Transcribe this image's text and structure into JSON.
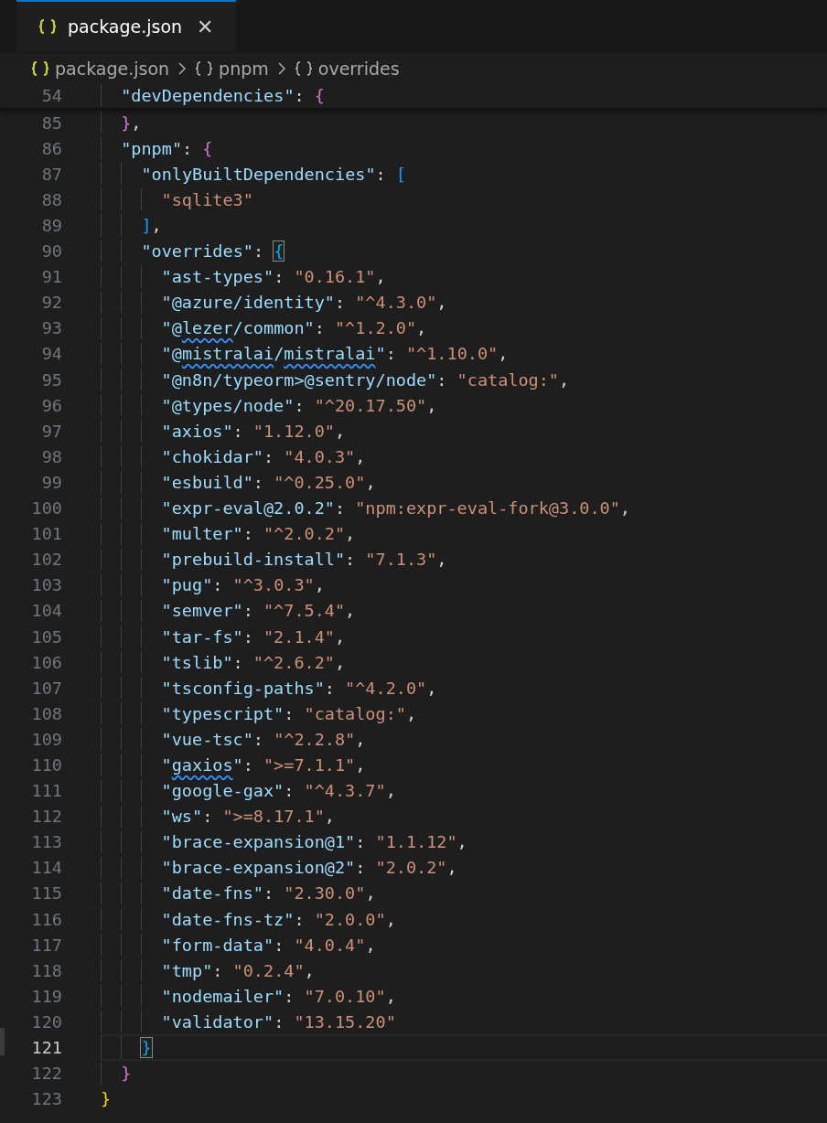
{
  "tab": {
    "title": "package.json",
    "selected": true,
    "close": "✕"
  },
  "breadcrumbs": [
    {
      "label": "package.json"
    },
    {
      "label": "pnpm"
    },
    {
      "label": "overrides"
    }
  ],
  "sticky_scroll": {
    "children": [
      {
        "number": "54",
        "current": false,
        "tokens": [
          {
            "kind": "key",
            "text": "\"devDependencies\""
          },
          {
            "kind": "punct",
            "text": ": "
          },
          {
            "kind": "brace-2",
            "text": "{"
          }
        ]
      }
    ]
  },
  "root_block": {
    "children": [
      {
        "number": "85",
        "current": false,
        "tokens": [
          {
            "kind": "brace-2",
            "text": "}"
          },
          {
            "kind": "punct",
            "text": ","
          }
        ]
      },
      {
        "number": "86",
        "current": false,
        "tokens": [
          {
            "kind": "key",
            "text": "\"pnpm\""
          },
          {
            "kind": "punct",
            "text": ": "
          },
          {
            "kind": "brace-2",
            "text": "{"
          }
        ],
        "children": [
          {
            "number": "87",
            "current": false,
            "tokens": [
              {
                "kind": "key",
                "text": "\"onlyBuiltDependencies\""
              },
              {
                "kind": "punct",
                "text": ": "
              },
              {
                "kind": "brace-3",
                "text": "["
              }
            ],
            "children": [
              {
                "number": "88",
                "current": false,
                "tokens": [
                  {
                    "kind": "string",
                    "text": "\"sqlite3\""
                  }
                ]
              }
            ]
          },
          {
            "number": "89",
            "current": false,
            "tokens": [
              {
                "kind": "brace-3",
                "text": "]"
              },
              {
                "kind": "punct",
                "text": ","
              }
            ]
          },
          {
            "number": "90",
            "current": false,
            "tokens": [
              {
                "kind": "key",
                "text": "\"overrides\""
              },
              {
                "kind": "punct",
                "text": ": "
              },
              {
                "kind": "brace-3",
                "text": "{",
                "matched": true
              }
            ],
            "children": [
              {
                "number": "91",
                "current": false,
                "tokens": [
                  {
                    "kind": "key",
                    "text": "\"ast-types\""
                  },
                  {
                    "kind": "punct",
                    "text": ": "
                  },
                  {
                    "kind": "string",
                    "text": "\"0.16.1\""
                  },
                  {
                    "kind": "punct",
                    "text": ","
                  }
                ]
              },
              {
                "number": "92",
                "current": false,
                "tokens": [
                  {
                    "kind": "key",
                    "text": "\"@azure/identity\""
                  },
                  {
                    "kind": "punct",
                    "text": ": "
                  },
                  {
                    "kind": "string",
                    "text": "\"^4.3.0\""
                  },
                  {
                    "kind": "punct",
                    "text": ","
                  }
                ]
              },
              {
                "number": "93",
                "current": false,
                "tokens": [
                  {
                    "kind": "key",
                    "text": "\"@"
                  },
                  {
                    "kind": "key",
                    "text": "lezer",
                    "squiggle": true
                  },
                  {
                    "kind": "key",
                    "text": "/common\""
                  },
                  {
                    "kind": "punct",
                    "text": ": "
                  },
                  {
                    "kind": "string",
                    "text": "\"^1.2.0\""
                  },
                  {
                    "kind": "punct",
                    "text": ","
                  }
                ]
              },
              {
                "number": "94",
                "current": false,
                "tokens": [
                  {
                    "kind": "key",
                    "text": "\"@"
                  },
                  {
                    "kind": "key",
                    "text": "mistralai",
                    "squiggle": true
                  },
                  {
                    "kind": "key",
                    "text": "/"
                  },
                  {
                    "kind": "key",
                    "text": "mistralai",
                    "squiggle": true
                  },
                  {
                    "kind": "key",
                    "text": "\""
                  },
                  {
                    "kind": "punct",
                    "text": ": "
                  },
                  {
                    "kind": "string",
                    "text": "\"^1.10.0\""
                  },
                  {
                    "kind": "punct",
                    "text": ","
                  }
                ]
              },
              {
                "number": "95",
                "current": false,
                "tokens": [
                  {
                    "kind": "key",
                    "text": "\"@n8n/typeorm>@sentry/node\""
                  },
                  {
                    "kind": "punct",
                    "text": ": "
                  },
                  {
                    "kind": "string",
                    "text": "\"catalog:\""
                  },
                  {
                    "kind": "punct",
                    "text": ","
                  }
                ]
              },
              {
                "number": "96",
                "current": false,
                "tokens": [
                  {
                    "kind": "key",
                    "text": "\"@types/node\""
                  },
                  {
                    "kind": "punct",
                    "text": ": "
                  },
                  {
                    "kind": "string",
                    "text": "\"^20.17.50\""
                  },
                  {
                    "kind": "punct",
                    "text": ","
                  }
                ]
              },
              {
                "number": "97",
                "current": false,
                "tokens": [
                  {
                    "kind": "key",
                    "text": "\"axios\""
                  },
                  {
                    "kind": "punct",
                    "text": ": "
                  },
                  {
                    "kind": "string",
                    "text": "\"1.12.0\""
                  },
                  {
                    "kind": "punct",
                    "text": ","
                  }
                ]
              },
              {
                "number": "98",
                "current": false,
                "tokens": [
                  {
                    "kind": "key",
                    "text": "\"chokidar\""
                  },
                  {
                    "kind": "punct",
                    "text": ": "
                  },
                  {
                    "kind": "string",
                    "text": "\"4.0.3\""
                  },
                  {
                    "kind": "punct",
                    "text": ","
                  }
                ]
              },
              {
                "number": "99",
                "current": false,
                "tokens": [
                  {
                    "kind": "key",
                    "text": "\"esbuild\""
                  },
                  {
                    "kind": "punct",
                    "text": ": "
                  },
                  {
                    "kind": "string",
                    "text": "\"^0.25.0\""
                  },
                  {
                    "kind": "punct",
                    "text": ","
                  }
                ]
              },
              {
                "number": "100",
                "current": false,
                "tokens": [
                  {
                    "kind": "key",
                    "text": "\"expr-eval@2.0.2\""
                  },
                  {
                    "kind": "punct",
                    "text": ": "
                  },
                  {
                    "kind": "string",
                    "text": "\"npm:expr-eval-fork@3.0.0\""
                  },
                  {
                    "kind": "punct",
                    "text": ","
                  }
                ]
              },
              {
                "number": "101",
                "current": false,
                "tokens": [
                  {
                    "kind": "key",
                    "text": "\"multer\""
                  },
                  {
                    "kind": "punct",
                    "text": ": "
                  },
                  {
                    "kind": "string",
                    "text": "\"^2.0.2\""
                  },
                  {
                    "kind": "punct",
                    "text": ","
                  }
                ]
              },
              {
                "number": "102",
                "current": false,
                "tokens": [
                  {
                    "kind": "key",
                    "text": "\"prebuild-install\""
                  },
                  {
                    "kind": "punct",
                    "text": ": "
                  },
                  {
                    "kind": "string",
                    "text": "\"7.1.3\""
                  },
                  {
                    "kind": "punct",
                    "text": ","
                  }
                ]
              },
              {
                "number": "103",
                "current": false,
                "tokens": [
                  {
                    "kind": "key",
                    "text": "\"pug\""
                  },
                  {
                    "kind": "punct",
                    "text": ": "
                  },
                  {
                    "kind": "string",
                    "text": "\"^3.0.3\""
                  },
                  {
                    "kind": "punct",
                    "text": ","
                  }
                ]
              },
              {
                "number": "104",
                "current": false,
                "tokens": [
                  {
                    "kind": "key",
                    "text": "\"semver\""
                  },
                  {
                    "kind": "punct",
                    "text": ": "
                  },
                  {
                    "kind": "string",
                    "text": "\"^7.5.4\""
                  },
                  {
                    "kind": "punct",
                    "text": ","
                  }
                ]
              },
              {
                "number": "105",
                "current": false,
                "tokens": [
                  {
                    "kind": "key",
                    "text": "\"tar-fs\""
                  },
                  {
                    "kind": "punct",
                    "text": ": "
                  },
                  {
                    "kind": "string",
                    "text": "\"2.1.4\""
                  },
                  {
                    "kind": "punct",
                    "text": ","
                  }
                ]
              },
              {
                "number": "106",
                "current": false,
                "tokens": [
                  {
                    "kind": "key",
                    "text": "\"tslib\""
                  },
                  {
                    "kind": "punct",
                    "text": ": "
                  },
                  {
                    "kind": "string",
                    "text": "\"^2.6.2\""
                  },
                  {
                    "kind": "punct",
                    "text": ","
                  }
                ]
              },
              {
                "number": "107",
                "current": false,
                "tokens": [
                  {
                    "kind": "key",
                    "text": "\"tsconfig-paths\""
                  },
                  {
                    "kind": "punct",
                    "text": ": "
                  },
                  {
                    "kind": "string",
                    "text": "\"^4.2.0\""
                  },
                  {
                    "kind": "punct",
                    "text": ","
                  }
                ]
              },
              {
                "number": "108",
                "current": false,
                "tokens": [
                  {
                    "kind": "key",
                    "text": "\"typescript\""
                  },
                  {
                    "kind": "punct",
                    "text": ": "
                  },
                  {
                    "kind": "string",
                    "text": "\"catalog:\""
                  },
                  {
                    "kind": "punct",
                    "text": ","
                  }
                ]
              },
              {
                "number": "109",
                "current": false,
                "tokens": [
                  {
                    "kind": "key",
                    "text": "\"vue-tsc\""
                  },
                  {
                    "kind": "punct",
                    "text": ": "
                  },
                  {
                    "kind": "string",
                    "text": "\"^2.2.8\""
                  },
                  {
                    "kind": "punct",
                    "text": ","
                  }
                ]
              },
              {
                "number": "110",
                "current": false,
                "tokens": [
                  {
                    "kind": "key",
                    "text": "\""
                  },
                  {
                    "kind": "key",
                    "text": "gaxios",
                    "squiggle": true
                  },
                  {
                    "kind": "key",
                    "text": "\""
                  },
                  {
                    "kind": "punct",
                    "text": ": "
                  },
                  {
                    "kind": "string",
                    "text": "\">=7.1.1\""
                  },
                  {
                    "kind": "punct",
                    "text": ","
                  }
                ]
              },
              {
                "number": "111",
                "current": false,
                "tokens": [
                  {
                    "kind": "key",
                    "text": "\"google-gax\""
                  },
                  {
                    "kind": "punct",
                    "text": ": "
                  },
                  {
                    "kind": "string",
                    "text": "\"^4.3.7\""
                  },
                  {
                    "kind": "punct",
                    "text": ","
                  }
                ]
              },
              {
                "number": "112",
                "current": false,
                "tokens": [
                  {
                    "kind": "key",
                    "text": "\"ws\""
                  },
                  {
                    "kind": "punct",
                    "text": ": "
                  },
                  {
                    "kind": "string",
                    "text": "\">=8.17.1\""
                  },
                  {
                    "kind": "punct",
                    "text": ","
                  }
                ]
              },
              {
                "number": "113",
                "current": false,
                "tokens": [
                  {
                    "kind": "key",
                    "text": "\"brace-expansion@1\""
                  },
                  {
                    "kind": "punct",
                    "text": ": "
                  },
                  {
                    "kind": "string",
                    "text": "\"1.1.12\""
                  },
                  {
                    "kind": "punct",
                    "text": ","
                  }
                ]
              },
              {
                "number": "114",
                "current": false,
                "tokens": [
                  {
                    "kind": "key",
                    "text": "\"brace-expansion@2\""
                  },
                  {
                    "kind": "punct",
                    "text": ": "
                  },
                  {
                    "kind": "string",
                    "text": "\"2.0.2\""
                  },
                  {
                    "kind": "punct",
                    "text": ","
                  }
                ]
              },
              {
                "number": "115",
                "current": false,
                "tokens": [
                  {
                    "kind": "key",
                    "text": "\"date-fns\""
                  },
                  {
                    "kind": "punct",
                    "text": ": "
                  },
                  {
                    "kind": "string",
                    "text": "\"2.30.0\""
                  },
                  {
                    "kind": "punct",
                    "text": ","
                  }
                ]
              },
              {
                "number": "116",
                "current": false,
                "tokens": [
                  {
                    "kind": "key",
                    "text": "\"date-fns-tz\""
                  },
                  {
                    "kind": "punct",
                    "text": ": "
                  },
                  {
                    "kind": "string",
                    "text": "\"2.0.0\""
                  },
                  {
                    "kind": "punct",
                    "text": ","
                  }
                ]
              },
              {
                "number": "117",
                "current": false,
                "tokens": [
                  {
                    "kind": "key",
                    "text": "\"form-data\""
                  },
                  {
                    "kind": "punct",
                    "text": ": "
                  },
                  {
                    "kind": "string",
                    "text": "\"4.0.4\""
                  },
                  {
                    "kind": "punct",
                    "text": ","
                  }
                ]
              },
              {
                "number": "118",
                "current": false,
                "tokens": [
                  {
                    "kind": "key",
                    "text": "\"tmp\""
                  },
                  {
                    "kind": "punct",
                    "text": ": "
                  },
                  {
                    "kind": "string",
                    "text": "\"0.2.4\""
                  },
                  {
                    "kind": "punct",
                    "text": ","
                  }
                ]
              },
              {
                "number": "119",
                "current": false,
                "tokens": [
                  {
                    "kind": "key",
                    "text": "\"nodemailer\""
                  },
                  {
                    "kind": "punct",
                    "text": ": "
                  },
                  {
                    "kind": "string",
                    "text": "\"7.0.10\""
                  },
                  {
                    "kind": "punct",
                    "text": ","
                  }
                ]
              },
              {
                "number": "120",
                "current": false,
                "tokens": [
                  {
                    "kind": "key",
                    "text": "\"validator\""
                  },
                  {
                    "kind": "punct",
                    "text": ": "
                  },
                  {
                    "kind": "string",
                    "text": "\"13.15.20\""
                  }
                ]
              }
            ]
          },
          {
            "number": "121",
            "current": true,
            "tokens": [
              {
                "kind": "brace-3",
                "text": "}",
                "matched": true
              }
            ]
          }
        ]
      },
      {
        "number": "122",
        "current": false,
        "tokens": [
          {
            "kind": "brace-2",
            "text": "}"
          }
        ]
      }
    ]
  },
  "end_lines": [
    {
      "number": "123",
      "current": false,
      "tokens": [
        {
          "kind": "brace-1",
          "text": "}"
        }
      ]
    }
  ]
}
